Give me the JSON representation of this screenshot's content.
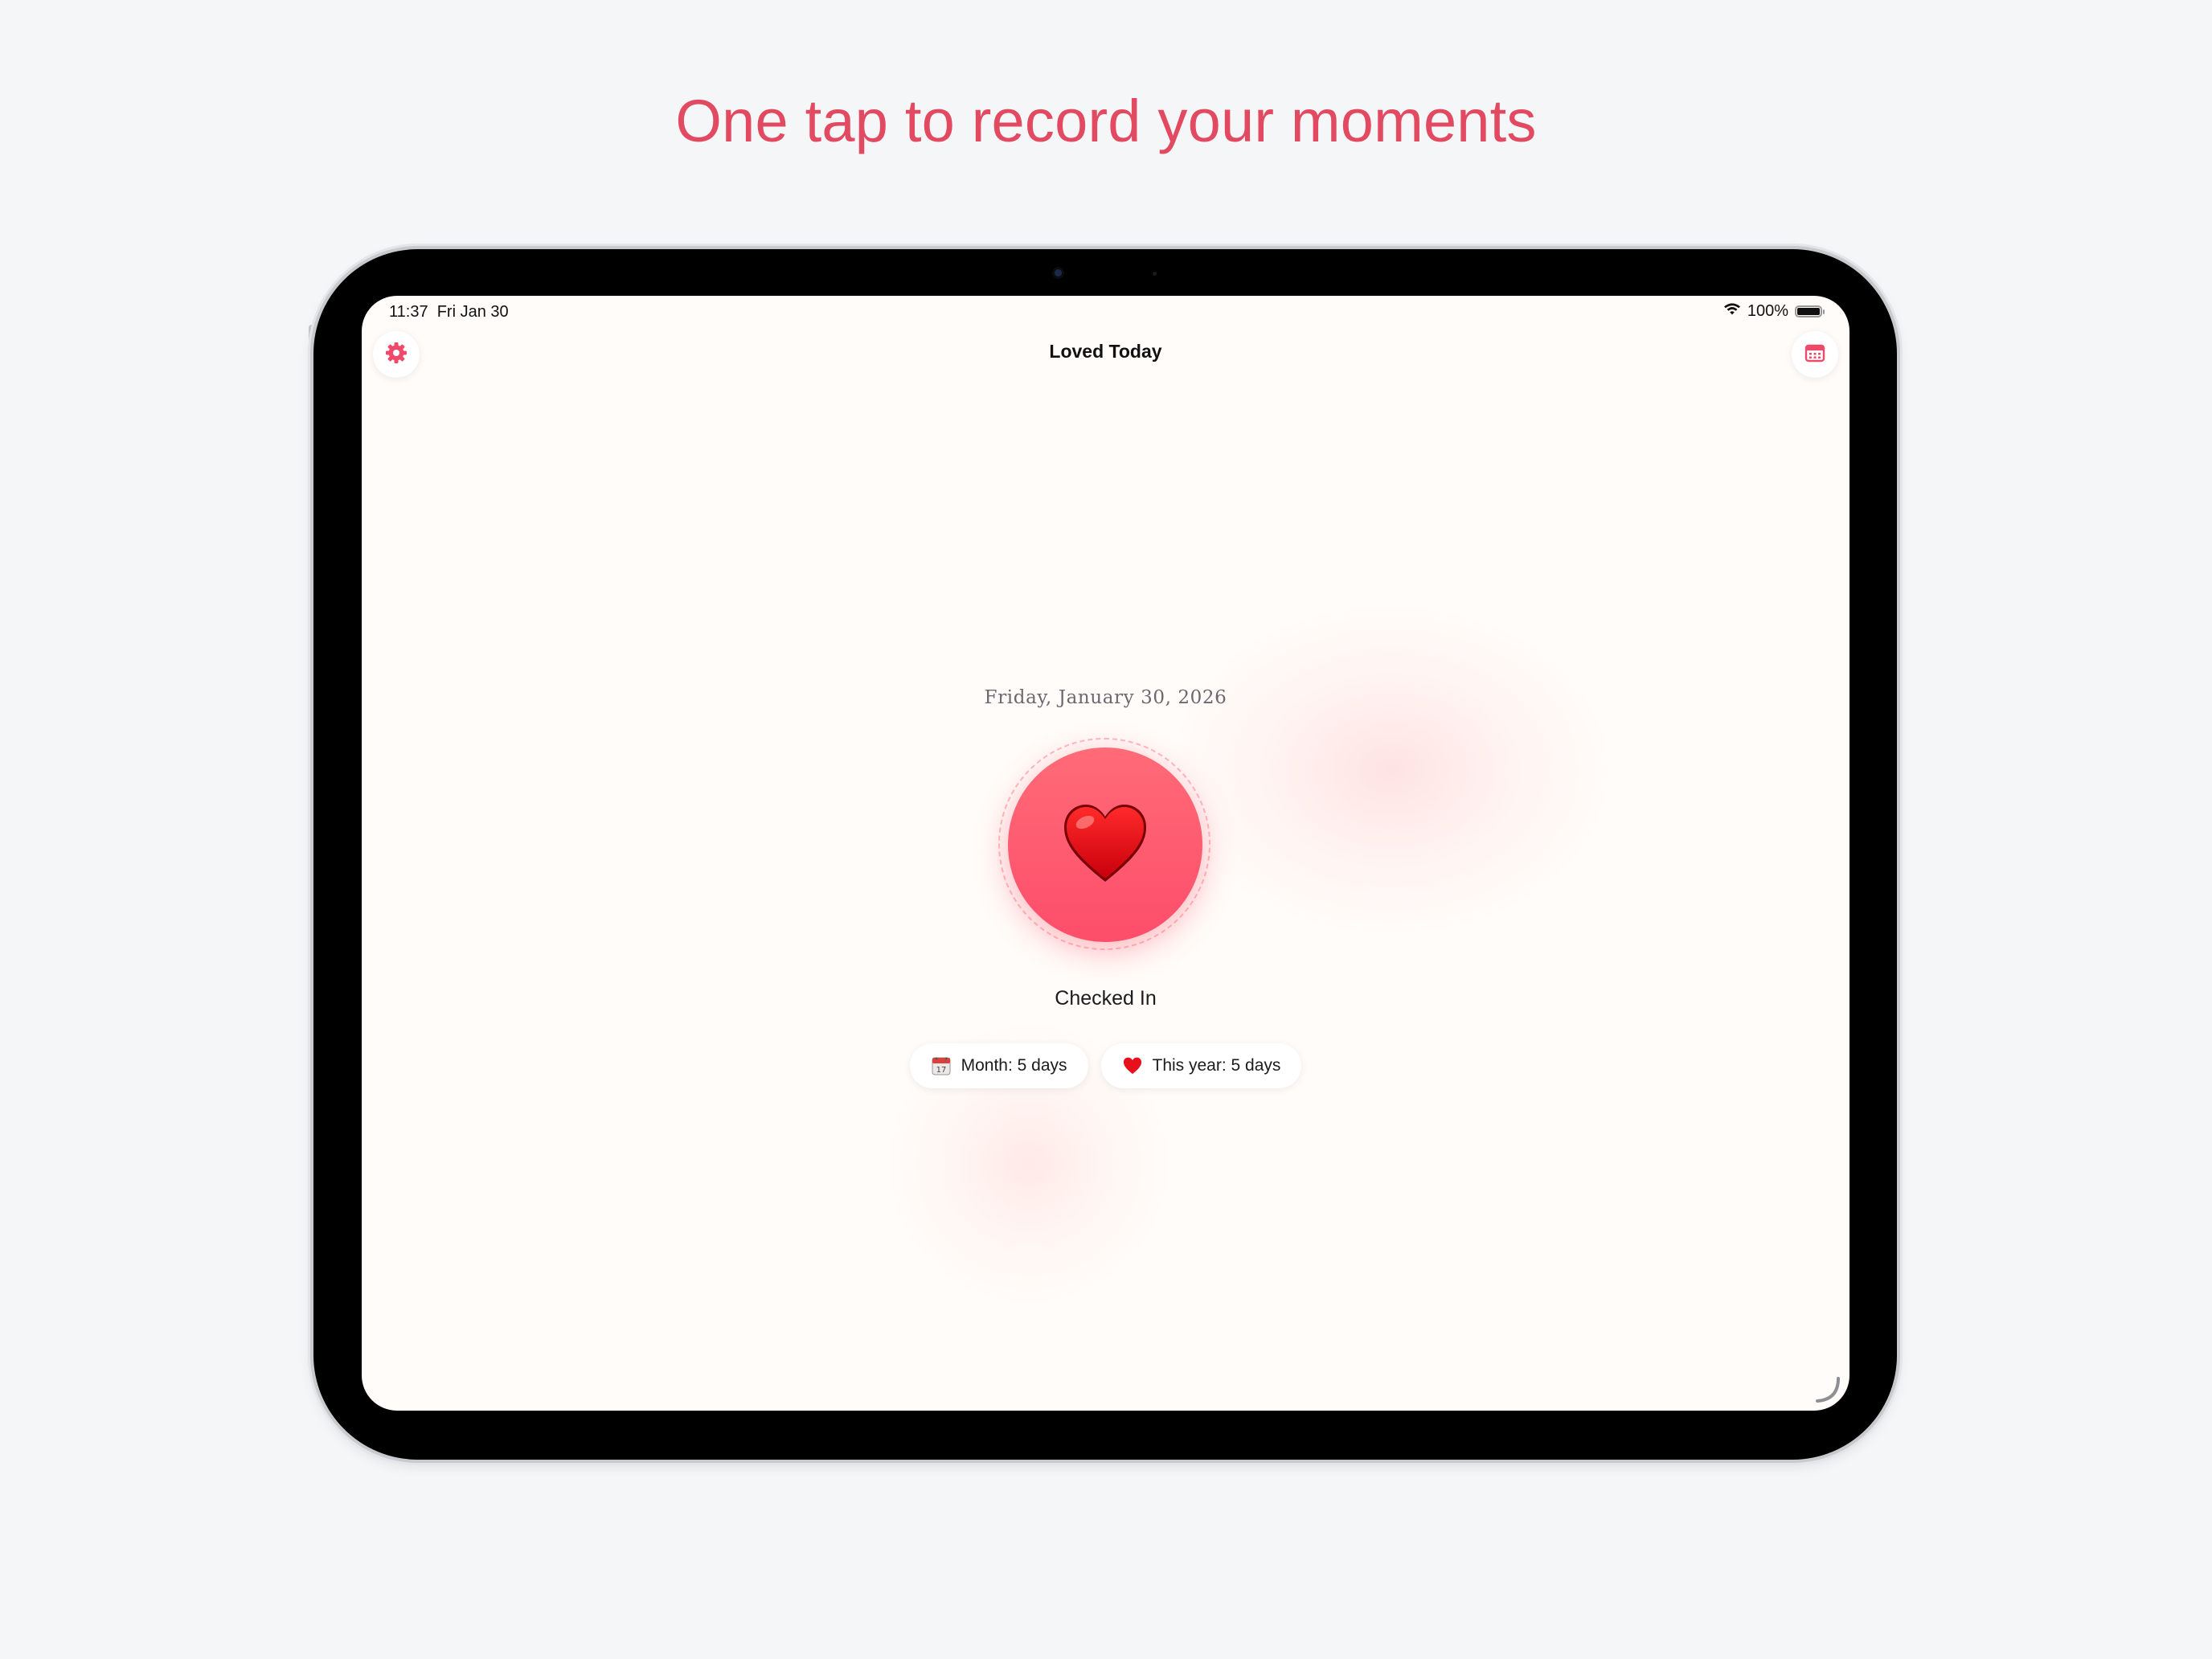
{
  "headline": "One tap to record your moments",
  "status_bar": {
    "time": "11:37",
    "date": "Fri Jan 30",
    "battery": "100%",
    "battery_level": 1.0
  },
  "nav": {
    "title": "Loved Today",
    "left_icon": "gear-icon",
    "right_icon": "calendar-icon"
  },
  "main": {
    "date": "Friday, January 30, 2026",
    "button_icon": "heart-emoji",
    "status": "Checked In"
  },
  "stats": [
    {
      "icon": "calendar-emoji-icon",
      "label": "Month: 5 days"
    },
    {
      "icon": "heart-emoji-icon",
      "label": "This year: 5 days"
    }
  ],
  "colors": {
    "accent": "#e24a61",
    "heart_button": "#fd5b6f",
    "screen_bg": "#fffcf9",
    "page_bg": "#f5f6f8"
  }
}
